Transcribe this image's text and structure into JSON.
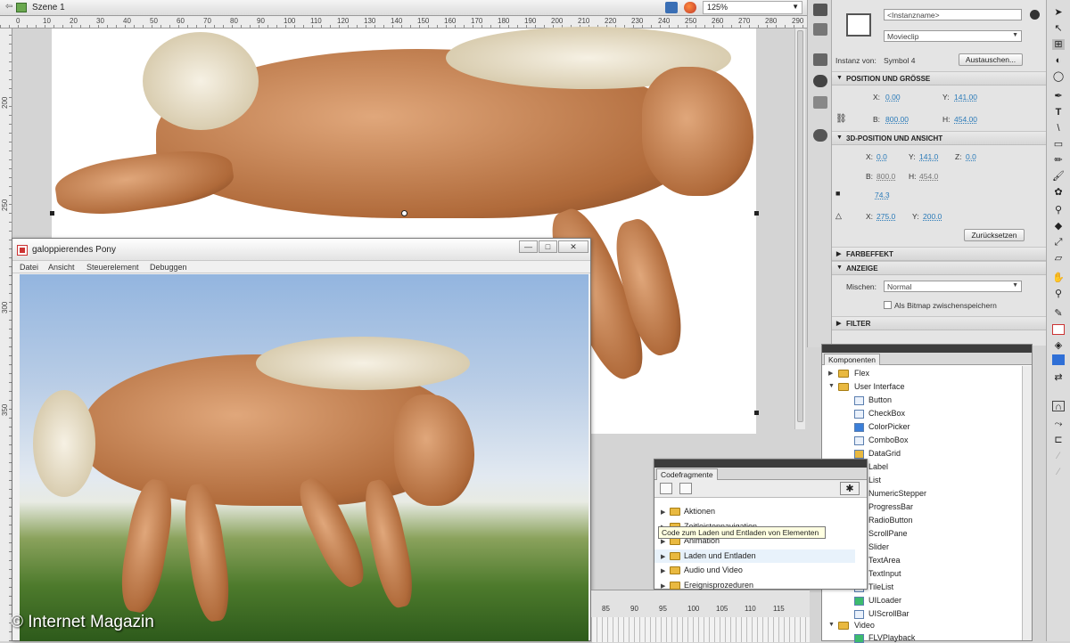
{
  "topbar": {
    "back": "⇦",
    "scene": "Szene 1",
    "zoom": "125%"
  },
  "rulers": {
    "h": [
      "0",
      "10",
      "20",
      "30",
      "40",
      "50",
      "60",
      "70",
      "80",
      "90",
      "100",
      "110",
      "120",
      "130",
      "140",
      "150",
      "160",
      "170",
      "180",
      "190",
      "200",
      "210",
      "220",
      "230",
      "240",
      "250",
      "260",
      "270",
      "280",
      "290"
    ],
    "v": [
      "200",
      "250",
      "300",
      "350"
    ]
  },
  "preview": {
    "title": "galoppierendes Pony",
    "menu": [
      "Datei",
      "Ansicht",
      "Steuerelement",
      "Debuggen"
    ],
    "buttons": {
      "minimize": "—",
      "maximize": "□",
      "close": "✕"
    }
  },
  "copyright": "© Internet Magazin",
  "properties": {
    "instance_placeholder": "<Instanzname>",
    "type": "Movieclip",
    "instance_of_label": "Instanz von:",
    "instance_of": "Symbol 4",
    "swap": "Austauschen...",
    "sections": {
      "position": "POSITION UND GRÖSSE",
      "three_d": "3D-POSITION UND ANSICHT",
      "color": "FARBEFFEKT",
      "display": "ANZEIGE",
      "filter": "FILTER"
    },
    "pos": {
      "x_label": "X:",
      "x": "0.00",
      "y_label": "Y:",
      "y": "141.00",
      "w_label": "B:",
      "w": "800.00",
      "h_label": "H:",
      "h": "454.00"
    },
    "pos3d": {
      "x_label": "X:",
      "x": "0.0",
      "y_label": "Y:",
      "y": "141.0",
      "z_label": "Z:",
      "z": "0.0",
      "w_label": "B:",
      "w": "800.0",
      "h_label": "H:",
      "h": "454.0",
      "persp": "74.3",
      "vx_label": "X:",
      "vx": "275.0",
      "vy_label": "Y:",
      "vy": "200.0",
      "reset": "Zurücksetzen"
    },
    "display": {
      "blend_label": "Mischen:",
      "blend": "Normal",
      "cache": "Als Bitmap zwischenspeichern"
    }
  },
  "components": {
    "tab": "Komponenten",
    "folders": [
      "Flex",
      "User Interface",
      "Video"
    ],
    "ui_items": [
      "Button",
      "CheckBox",
      "ColorPicker",
      "ComboBox",
      "DataGrid",
      "Label",
      "List",
      "NumericStepper",
      "ProgressBar",
      "RadioButton",
      "ScrollPane",
      "Slider",
      "TextArea",
      "TextInput",
      "TileList",
      "UILoader",
      "UIScrollBar"
    ],
    "video_items": [
      "FLVPlayback"
    ]
  },
  "codefrag": {
    "tab": "Codefragmente",
    "folders": [
      "Aktionen",
      "Zeitleistennavigation",
      "Animation",
      "Laden und Entladen",
      "Audio und Video",
      "Ereignisprozeduren"
    ],
    "tooltip": "Code zum Laden und Entladen von Elementen"
  },
  "timeline": {
    "frames": [
      "85",
      "90",
      "95",
      "100",
      "105",
      "110",
      "115"
    ]
  },
  "colors": {
    "accent": "#2a7ab8",
    "panel": "#e4e4e4",
    "stage": "#ffffff"
  }
}
